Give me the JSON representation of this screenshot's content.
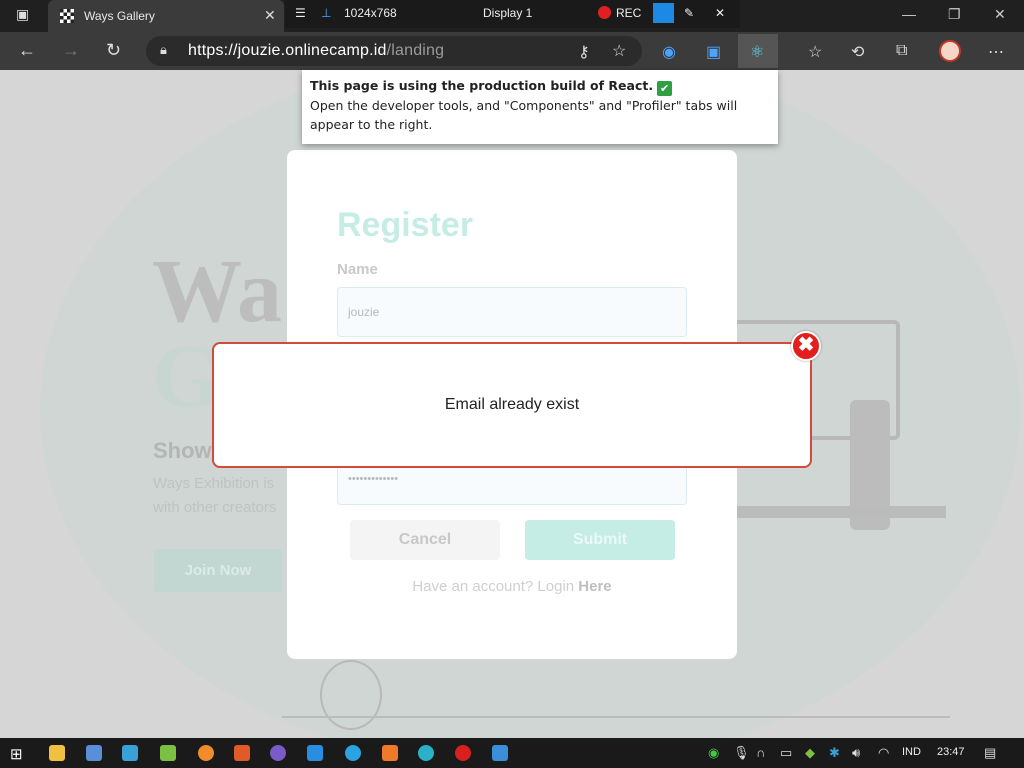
{
  "titlebar": {
    "tab_title": "Ways Gallery",
    "capture_size": "1024x768",
    "display_label": "Display 1",
    "rec_label": "REC"
  },
  "address": {
    "url_host": "https://jouzie.onlinecamp.id",
    "url_path": "/landing"
  },
  "react_popup": {
    "title": "This page is using the production build of React.",
    "body": "Open the developer tools, and \"Components\" and \"Profiler\" tabs will appear to the right."
  },
  "hero": {
    "title_line1": "Wa",
    "title_line2": "G",
    "subtitle": "Show",
    "text_line1": "Ways Exhibition is",
    "text_line2": "with other creators",
    "join_button": "Join Now"
  },
  "register": {
    "heading": "Register",
    "name_label": "Name",
    "name_value": "jouzie",
    "password_value": "•••••••••••••",
    "cancel_button": "Cancel",
    "submit_button": "Submit",
    "login_prompt": "Have an account? Login",
    "login_link": "Here"
  },
  "modal": {
    "message": "Email already exist",
    "close_glyph": "✖"
  },
  "taskbar": {
    "language": "IND",
    "time": "23:47"
  }
}
